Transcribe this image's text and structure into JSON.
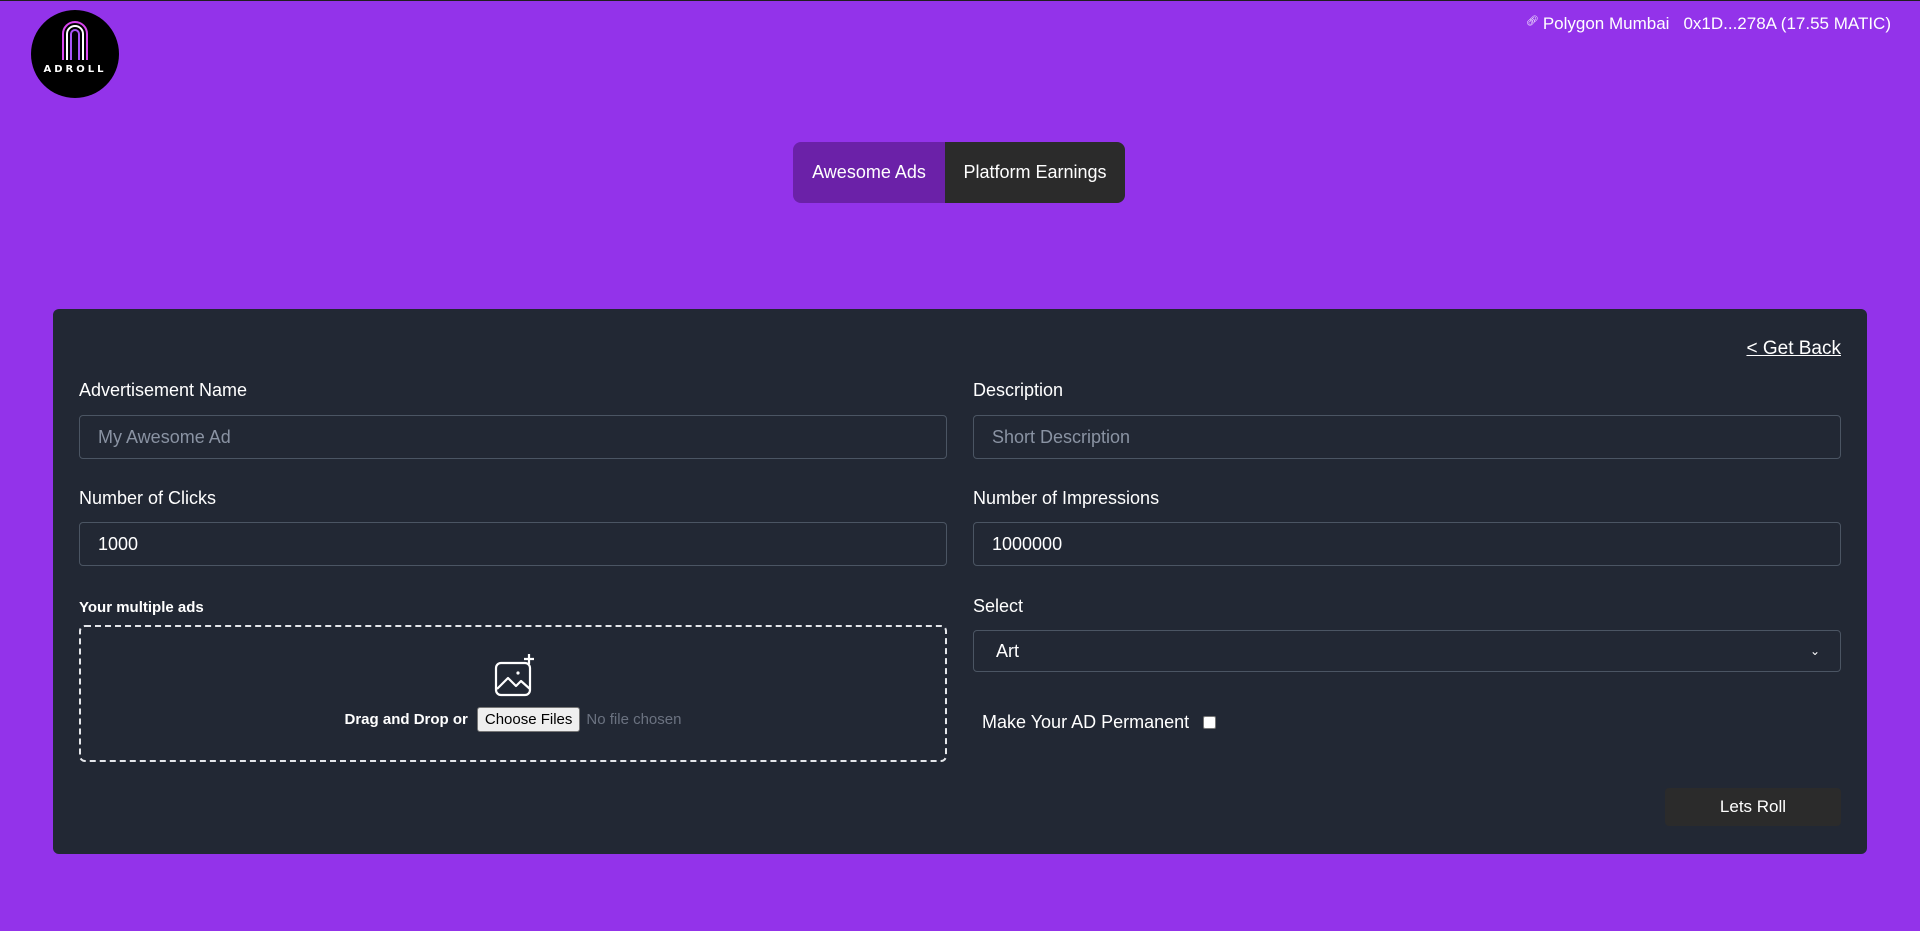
{
  "app": {
    "logo_text": "ADROLL",
    "network": "Polygon Mumbai",
    "account": "0x1D...278A (17.55 MATIC)",
    "accent_color": "#9333ea"
  },
  "tabs": [
    {
      "label": "Awesome Ads",
      "active": true
    },
    {
      "label": "Platform Earnings",
      "active": false
    }
  ],
  "form": {
    "back_label": "< Get Back",
    "ad_name": {
      "label": "Advertisement Name",
      "placeholder": "My Awesome Ad",
      "value": ""
    },
    "description": {
      "label": "Description",
      "placeholder": "Short Description",
      "value": ""
    },
    "clicks": {
      "label": "Number of Clicks",
      "value": "1000"
    },
    "impressions": {
      "label": "Number of Impressions",
      "value": "1000000"
    },
    "uploads": {
      "label": "Your multiple ads",
      "drag_text": "Drag and Drop or",
      "choose_label": "Choose Files",
      "status": "No file chosen",
      "icon": "image-add-icon"
    },
    "category": {
      "label": "Select",
      "value": "Art"
    },
    "permanent": {
      "label": "Make Your AD Permanent",
      "checked": false
    },
    "submit_label": "Lets Roll"
  }
}
